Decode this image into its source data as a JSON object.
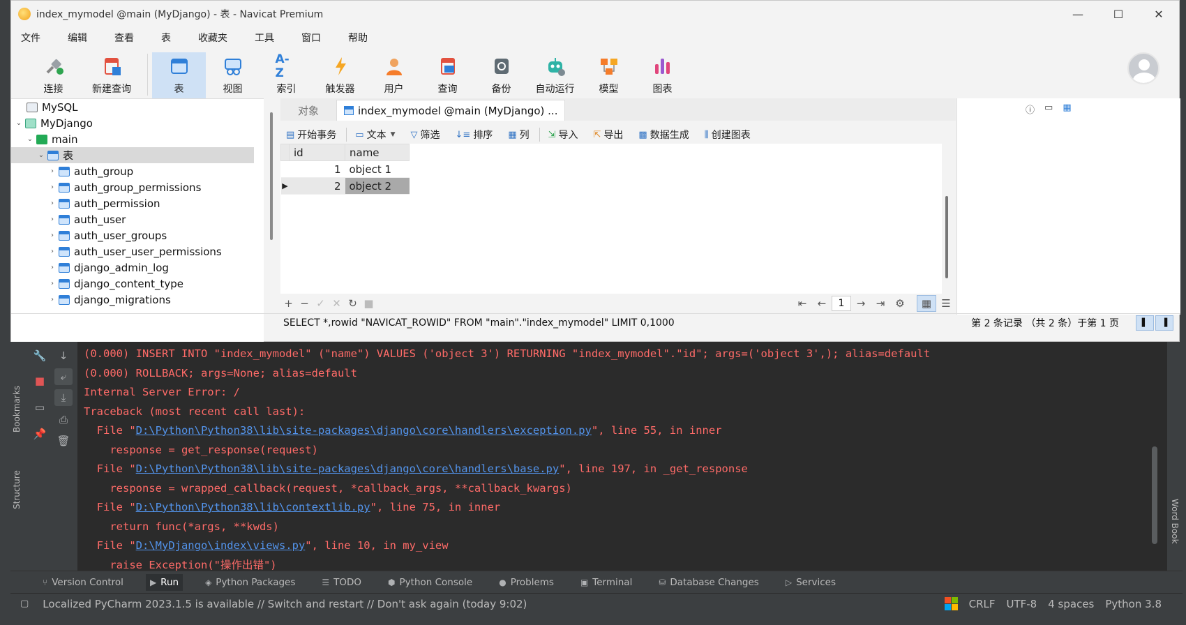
{
  "navicat": {
    "title": "index_mymodel @main (MyDjango) - 表 - Navicat Premium",
    "window_buttons": [
      "—",
      "☐",
      "✕"
    ],
    "menu": [
      "文件",
      "编辑",
      "查看",
      "表",
      "收藏夹",
      "工具",
      "窗口",
      "帮助"
    ],
    "toolbar": [
      {
        "label": "连接",
        "icon": "connect-icon"
      },
      {
        "label": "新建查询",
        "icon": "new-query-icon"
      },
      {
        "label": "表",
        "icon": "table-icon"
      },
      {
        "label": "视图",
        "icon": "view-icon"
      },
      {
        "label": "索引",
        "icon": "index-icon",
        "glyph": "A-Z"
      },
      {
        "label": "触发器",
        "icon": "trigger-icon"
      },
      {
        "label": "用户",
        "icon": "user-icon"
      },
      {
        "label": "查询",
        "icon": "query-icon"
      },
      {
        "label": "备份",
        "icon": "backup-icon"
      },
      {
        "label": "自动运行",
        "icon": "automation-icon"
      },
      {
        "label": "模型",
        "icon": "model-icon"
      },
      {
        "label": "图表",
        "icon": "chart-icon"
      }
    ],
    "tree": {
      "root": "MySQL",
      "connection": "MyDjango",
      "database": "main",
      "tables_node": "表",
      "tables": [
        "auth_group",
        "auth_group_permissions",
        "auth_permission",
        "auth_user",
        "auth_user_groups",
        "auth_user_user_permissions",
        "django_admin_log",
        "django_content_type",
        "django_migrations"
      ]
    },
    "tabs": {
      "objects": "对象",
      "active": "index_mymodel @main (MyDjango) ..."
    },
    "grid_toolbar": {
      "begin_tx": "开始事务",
      "text": "文本",
      "filter": "筛选",
      "sort": "排序",
      "columns": "列",
      "import": "导入",
      "export": "导出",
      "data_gen": "数据生成",
      "create_chart": "创建图表"
    },
    "grid": {
      "columns": [
        "id",
        "name"
      ],
      "rows": [
        {
          "id": "1",
          "name": "object 1"
        },
        {
          "id": "2",
          "name": "object 2"
        }
      ]
    },
    "nav": {
      "left": [
        "+",
        "−",
        "✓",
        "✕",
        "↻",
        "■"
      ],
      "right": [
        "⇤",
        "←",
        "→",
        "⇥",
        "⚙"
      ],
      "page": "1"
    },
    "status": {
      "sql": "SELECT *,rowid \"NAVICAT_ROWID\" FROM \"main\".\"index_mymodel\" LIMIT 0,1000",
      "records": "第 2 条记录 （共 2 条）于第 1 页"
    }
  },
  "pycharm": {
    "side_labels": {
      "bookmarks": "Bookmarks",
      "structure": "Structure",
      "word_book": "Word Book"
    },
    "console": [
      {
        "text": "(0.000) INSERT INTO \"index_mymodel\" (\"name\") VALUES ('object 3') RETURNING \"index_mymodel\".\"id\"; args=('object 3',); alias=default"
      },
      {
        "text": "(0.000) ROLLBACK; args=None; alias=default"
      },
      {
        "text": "Internal Server Error: /"
      },
      {
        "text": "Traceback (most recent call last):"
      },
      {
        "prefix": "  File \"",
        "link": "D:\\Python\\Python38\\lib\\site-packages\\django\\core\\handlers\\exception.py",
        "suffix": "\", line 55, in inner"
      },
      {
        "text": "    response = get_response(request)"
      },
      {
        "prefix": "  File \"",
        "link": "D:\\Python\\Python38\\lib\\site-packages\\django\\core\\handlers\\base.py",
        "suffix": "\", line 197, in _get_response"
      },
      {
        "text": "    response = wrapped_callback(request, *callback_args, **callback_kwargs)"
      },
      {
        "prefix": "  File \"",
        "link": "D:\\Python\\Python38\\lib\\contextlib.py",
        "suffix": "\", line 75, in inner"
      },
      {
        "text": "    return func(*args, **kwds)"
      },
      {
        "prefix": "  File \"",
        "link": "D:\\MyDjango\\index\\views.py",
        "suffix": "\", line 10, in my_view"
      },
      {
        "text": "    raise Exception(\"操作出错\")"
      }
    ],
    "tool_tabs": [
      {
        "label": "Version Control",
        "icon": "branch-icon"
      },
      {
        "label": "Run",
        "icon": "run-icon",
        "active": true
      },
      {
        "label": "Python Packages",
        "icon": "packages-icon"
      },
      {
        "label": "TODO",
        "icon": "todo-icon"
      },
      {
        "label": "Python Console",
        "icon": "python-console-icon"
      },
      {
        "label": "Problems",
        "icon": "problems-icon"
      },
      {
        "label": "Terminal",
        "icon": "terminal-icon"
      },
      {
        "label": "Database Changes",
        "icon": "database-changes-icon"
      },
      {
        "label": "Services",
        "icon": "services-icon"
      }
    ],
    "status": {
      "message": "Localized PyCharm 2023.1.5 is available // Switch and restart // Don't ask again (today 9:02)",
      "line_sep": "CRLF",
      "encoding": "UTF-8",
      "indent": "4 spaces",
      "interpreter": "Python 3.8"
    }
  },
  "colors": {
    "console_error": "#ff6b68",
    "console_link": "#5394ec",
    "navicat_active": "#cfe1f5",
    "pycharm_bg": "#2b2b2b"
  }
}
